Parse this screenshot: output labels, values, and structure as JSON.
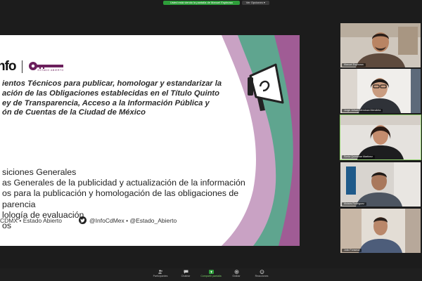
{
  "top_bar": {
    "share_status": "Usted está viendo la pantalla de Manuel Espinosa",
    "view_options": "Ver Opciones"
  },
  "slide": {
    "logo_text": "nfo",
    "logo_key_text": "ESTADO ABIERTO",
    "title_lines": [
      "ientos Técnicos para publicar, homologar y estandarizar la",
      "ación de las Obligaciones establecidas en el Título Quinto",
      "ey de Transparencia, Acceso a la Información Pública y",
      "ón de Cuentas de la Ciudad de México"
    ],
    "bullets": [
      "siciones Generales",
      "as Generales de la publicidad y actualización de la información",
      "os para la publicación y homologación de las obligaciones de",
      "parencia",
      "lología de evaluación",
      "os"
    ],
    "footer_left": "CDMX • Estado Abierto",
    "footer_right": "@InfoCdMex • @Estado_Abierto"
  },
  "participants": [
    {
      "name": "Manuel Espinosa"
    },
    {
      "name": "Jorge Jofrani Mendoza Mendieta"
    },
    {
      "name": "Sonia Quintanar Martínez"
    },
    {
      "name": "Moisés Rodríguez"
    },
    {
      "name": "Julio Fonseca"
    }
  ],
  "toolbar": [
    {
      "label": "Participantes",
      "icon": "participants-icon"
    },
    {
      "label": "Chatear",
      "icon": "chat-icon"
    },
    {
      "label": "Compartir pantalla",
      "icon": "share-screen-icon"
    },
    {
      "label": "Grabar",
      "icon": "record-icon"
    },
    {
      "label": "Reacciones",
      "icon": "reactions-icon"
    }
  ],
  "colors": {
    "teal": "#5fa58f",
    "magenta": "#a05c95",
    "share_green": "#2e9e3a",
    "logo_purple": "#6b1f5c"
  }
}
